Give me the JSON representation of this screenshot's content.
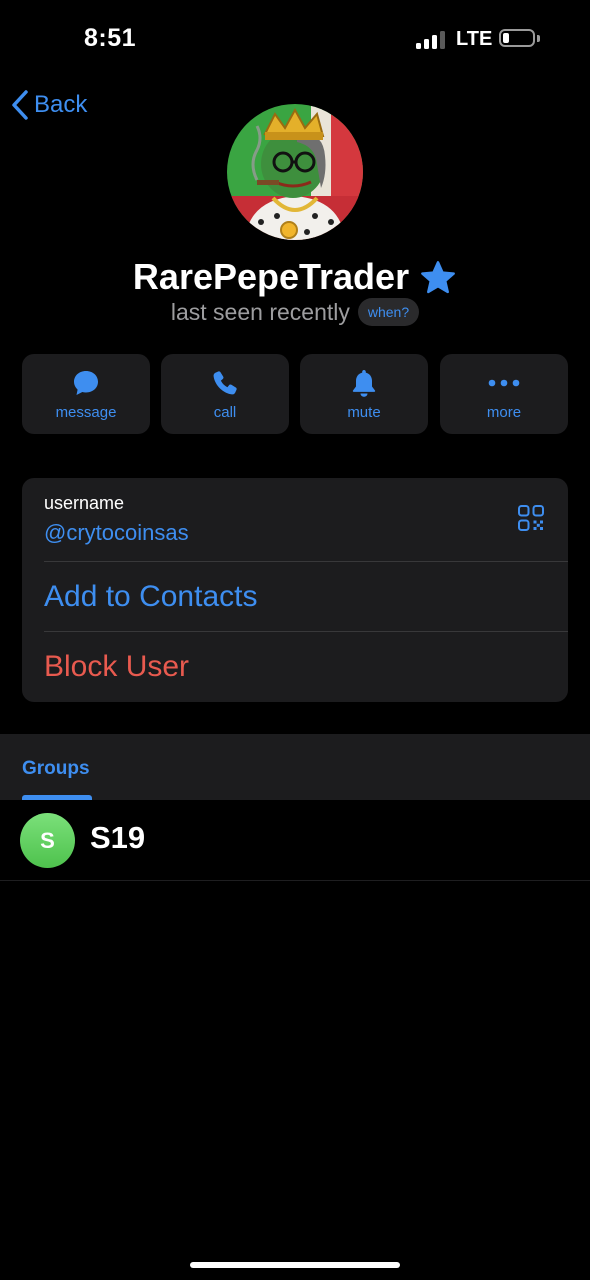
{
  "status_bar": {
    "time": "8:51",
    "network": "LTE",
    "signal_bars_filled": 3,
    "signal_bars_total": 4,
    "battery_level": 0.2
  },
  "nav": {
    "back_label": "Back"
  },
  "profile": {
    "name": "RarePepeTrader",
    "status": "last seen recently",
    "when_label": "when?",
    "accent_color": "#3e8ef0",
    "premium_icon": "star-icon"
  },
  "actions": [
    {
      "label": "message",
      "icon": "message-bubble-icon"
    },
    {
      "label": "call",
      "icon": "phone-icon"
    },
    {
      "label": "mute",
      "icon": "bell-icon"
    },
    {
      "label": "more",
      "icon": "ellipsis-icon"
    }
  ],
  "info": {
    "username_label": "username",
    "username_value": "@crytocoinsas",
    "add_contacts": "Add to Contacts",
    "block_user": "Block User",
    "danger_color": "#e85a4f"
  },
  "tabs": {
    "groups_label": "Groups"
  },
  "groups": [
    {
      "initial": "S",
      "name": "S19",
      "avatar_color": "#5ccf5b"
    }
  ]
}
